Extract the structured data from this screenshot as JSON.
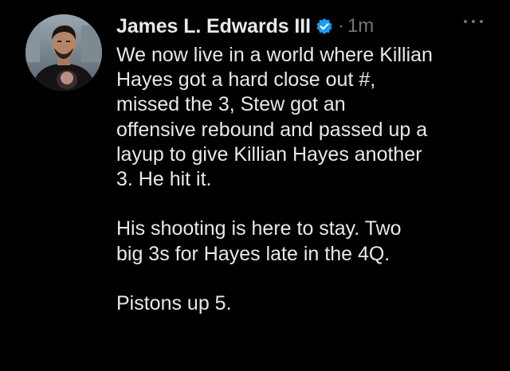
{
  "tweet": {
    "author_name": "James L. Edwards III",
    "time_separator": "·",
    "time": "1m",
    "verified_icon": "verified-badge-icon",
    "more_icon": "more-options-icon",
    "accent_color": "#1d9bf0",
    "paragraphs": [
      {
        "lines": [
          "We now live in a world where Killian",
          "Hayes got a hard close out #,",
          "missed the 3, Stew got an",
          "offensive rebound and passed up a",
          "layup to give Killian Hayes another",
          "3. He hit it."
        ]
      },
      {
        "lines": [
          "His shooting is here to stay. Two",
          "big 3s for Hayes late in the 4Q."
        ]
      },
      {
        "lines": [
          "Pistons up 5."
        ]
      }
    ]
  }
}
